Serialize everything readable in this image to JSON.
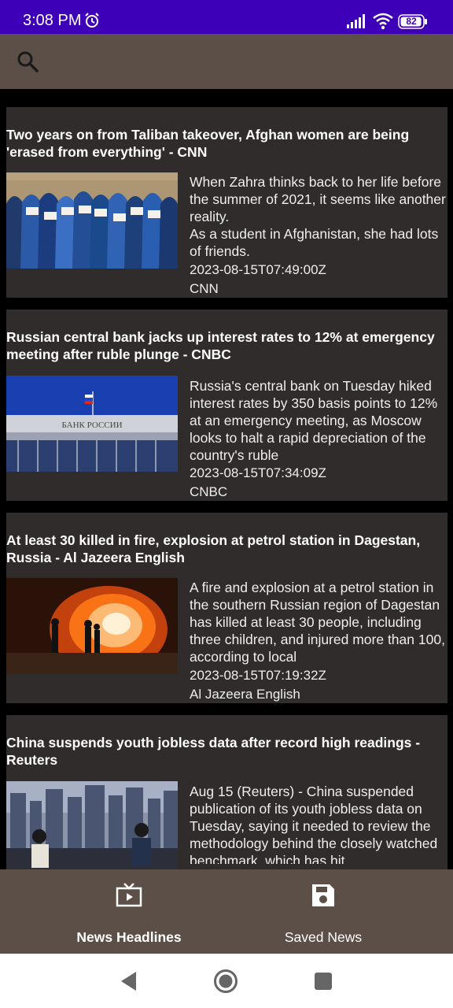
{
  "status_bar": {
    "time": "3:08 PM",
    "battery": "82"
  },
  "articles": [
    {
      "title": "Two years on from Taliban takeover, Afghan women are being 'erased from everything' - CNN",
      "description": "When Zahra thinks back to her life before the summer of 2021, it seems like another reality.\nAs a student in Afghanistan, she had lots of friends.",
      "date": "2023-08-15T07:49:00Z",
      "source": "CNN",
      "image": "afghan-women-protest-photo"
    },
    {
      "title": "Russian central bank jacks up interest rates to 12% at emergency meeting after ruble plunge - CNBC",
      "description": "Russia's central bank on Tuesday hiked interest rates by 350 basis points to 12% at an emergency meeting, as Moscow looks to halt a rapid depreciation of the country's ruble",
      "date": "2023-08-15T07:34:09Z",
      "source": "CNBC",
      "image": "bank-of-russia-building-photo",
      "image_sign_text": "БАНК РОССИИ"
    },
    {
      "title": "At least 30 killed in fire, explosion at petrol station in Dagestan, Russia - Al Jazeera English",
      "description": "A fire and explosion at a petrol station in the southern Russian region of Dagestan has killed at least 30 people, including three children, and injured more than 100, according to local",
      "date": "2023-08-15T07:19:32Z",
      "source": "Al Jazeera English",
      "image": "petrol-station-fire-photo"
    },
    {
      "title": "China suspends youth jobless data after record high readings - Reuters",
      "description": "Aug 15 (Reuters) - China suspended publication of its youth jobless data on Tuesday, saying it needed to review the methodology behind the closely watched benchmark, which has hit",
      "date": "",
      "source": "",
      "image": "china-city-skyline-photo"
    }
  ],
  "bottom_nav": {
    "items": [
      {
        "label": "News Headlines",
        "icon": "tv-icon",
        "active": true
      },
      {
        "label": "Saved News",
        "icon": "save-icon",
        "active": false
      }
    ]
  },
  "colors": {
    "status_bar": "#3d00b8",
    "app_bar": "#5b4f47",
    "card": "#2f2c2b",
    "background": "#000000"
  }
}
